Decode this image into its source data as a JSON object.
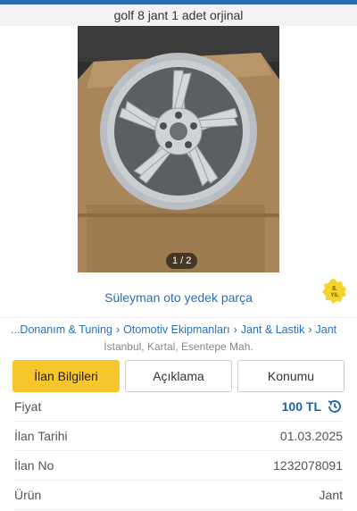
{
  "title": "golf 8 jant 1 adet orjinal",
  "gallery": {
    "counter": "1 / 2"
  },
  "seller": {
    "name": "Süleyman oto yedek parça",
    "badge_text": "8. YIL"
  },
  "breadcrumb": [
    "...Donanım & Tuning",
    "Otomotiv Ekipmanları",
    "Jant & Lastik",
    "Jant"
  ],
  "location": "İstanbul, Kartal, Esentepe Mah.",
  "tabs": [
    {
      "label": "İlan Bilgileri",
      "active": true
    },
    {
      "label": "Açıklama",
      "active": false
    },
    {
      "label": "Konumu",
      "active": false
    }
  ],
  "details": [
    {
      "label": "Fiyat",
      "value": "100 TL"
    },
    {
      "label": "İlan Tarihi",
      "value": "01.03.2025"
    },
    {
      "label": "İlan No",
      "value": "1232078091"
    },
    {
      "label": "Ürün",
      "value": "Jant"
    }
  ],
  "colors": {
    "accent": "#f6c62a",
    "link": "#2a6ebb",
    "price": "#1d5fb0",
    "ilan_no": "#c0392b"
  }
}
